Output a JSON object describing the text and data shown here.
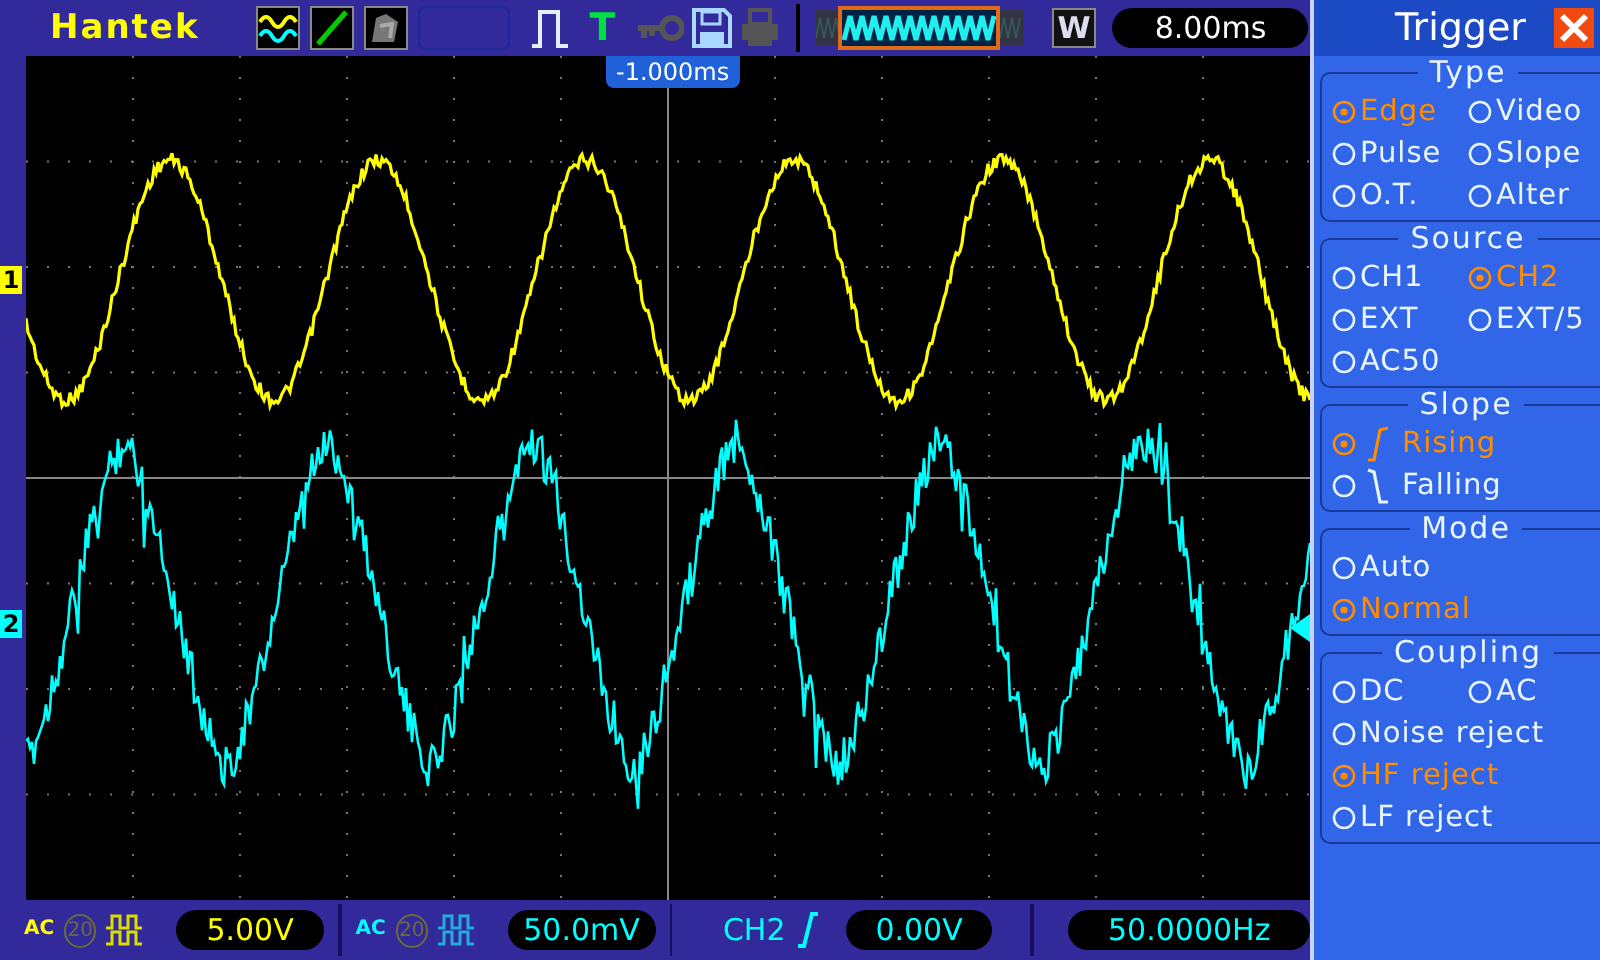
{
  "header": {
    "brand": "Hantek",
    "trigger_status": "T",
    "trigger_position": "-1.000ms",
    "memory_label": "W",
    "timebase": "8.00ms"
  },
  "channels": [
    {
      "marker": "1",
      "color": "#ffff00",
      "coupling": "AC",
      "bw_limit": {
        "label": "20",
        "on": false
      },
      "volts_div": "5.00V"
    },
    {
      "marker": "2",
      "color": "#00ffff",
      "coupling": "AC",
      "bw_limit": {
        "label": "20",
        "on": false
      },
      "volts_div": "50.0mV"
    }
  ],
  "trigger_readout": {
    "source": "CH2",
    "kind": "rising",
    "level": "0.00V",
    "frequency": "50.0000Hz"
  },
  "trigger_menu": {
    "title": "Trigger",
    "sections": [
      {
        "title": "Type",
        "rows": [
          [
            {
              "label": "Edge",
              "selected": true
            },
            {
              "label": "Video",
              "selected": false
            }
          ],
          [
            {
              "label": "Pulse",
              "selected": false
            },
            {
              "label": "Slope",
              "selected": false
            }
          ],
          [
            {
              "label": "O.T.",
              "selected": false
            },
            {
              "label": "Alter",
              "selected": false
            }
          ]
        ]
      },
      {
        "title": "Source",
        "rows": [
          [
            {
              "label": "CH1",
              "selected": false
            },
            {
              "label": "CH2",
              "selected": true
            }
          ],
          [
            {
              "label": "EXT",
              "selected": false
            },
            {
              "label": "EXT/5",
              "selected": false
            }
          ],
          [
            {
              "label": "AC50",
              "selected": false
            }
          ]
        ]
      },
      {
        "title": "Slope",
        "rows": [
          [
            {
              "label": "Rising",
              "selected": true,
              "kind": "rising"
            }
          ],
          [
            {
              "label": "Falling",
              "selected": false,
              "kind": "falling"
            }
          ]
        ]
      },
      {
        "title": "Mode",
        "rows": [
          [
            {
              "label": "Auto",
              "selected": false
            }
          ],
          [
            {
              "label": "Normal",
              "selected": true
            }
          ]
        ]
      },
      {
        "title": "Coupling",
        "rows": [
          [
            {
              "label": "DC",
              "selected": false
            },
            {
              "label": "AC",
              "selected": false
            }
          ],
          [
            {
              "label": "Noise reject",
              "selected": false
            }
          ],
          [
            {
              "label": "HF reject",
              "selected": true
            }
          ],
          [
            {
              "label": "LF reject",
              "selected": false
            }
          ]
        ]
      }
    ]
  }
}
